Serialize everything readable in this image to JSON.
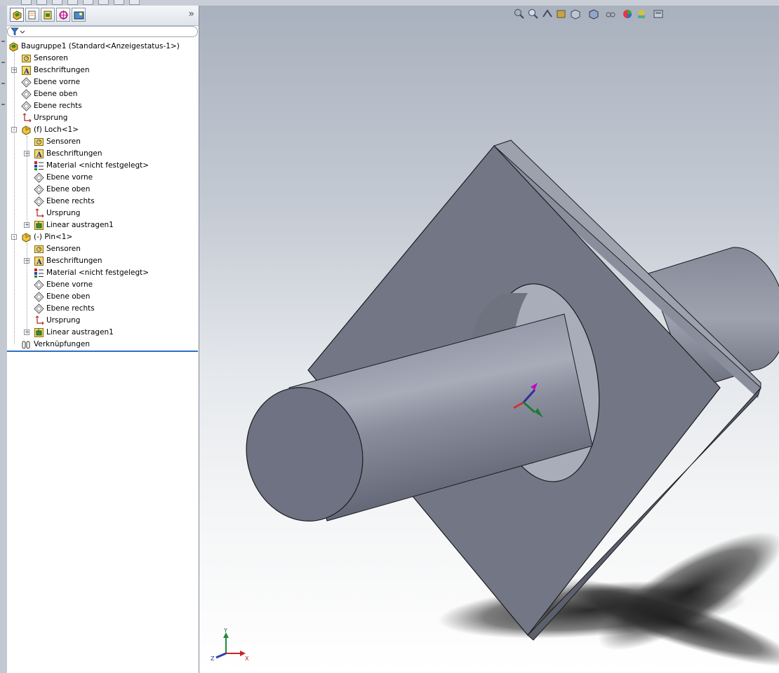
{
  "tree": {
    "root_label": "Baugruppe1  (Standard<Anzeigestatus-1>)",
    "items": [
      {
        "label": "Sensoren",
        "icon": "sensor-icon"
      },
      {
        "label": "Beschriftungen",
        "icon": "annotation-icon"
      },
      {
        "label": "Ebene vorne",
        "icon": "plane-icon"
      },
      {
        "label": "Ebene oben",
        "icon": "plane-icon"
      },
      {
        "label": "Ebene rechts",
        "icon": "plane-icon"
      },
      {
        "label": "Ursprung",
        "icon": "origin-icon"
      }
    ],
    "part1": {
      "label": "(f) Loch<1>",
      "children": [
        {
          "label": "Sensoren"
        },
        {
          "label": "Beschriftungen"
        },
        {
          "label": "Material <nicht festgelegt>"
        },
        {
          "label": "Ebene vorne"
        },
        {
          "label": "Ebene oben"
        },
        {
          "label": "Ebene rechts"
        },
        {
          "label": "Ursprung"
        },
        {
          "label": "Linear austragen1"
        }
      ]
    },
    "part2": {
      "label": "(-) Pin<1>",
      "children": [
        {
          "label": "Sensoren"
        },
        {
          "label": "Beschriftungen"
        },
        {
          "label": "Material <nicht festgelegt>"
        },
        {
          "label": "Ebene vorne"
        },
        {
          "label": "Ebene oben"
        },
        {
          "label": "Ebene rechts"
        },
        {
          "label": "Ursprung"
        },
        {
          "label": "Linear austragen1"
        }
      ]
    },
    "mates_label": "Verknüpfungen"
  },
  "panel": {
    "more_chevron": "»"
  },
  "triad": {
    "x": "X",
    "y": "Y",
    "z": "Z"
  },
  "colors": {
    "model_gray": "#7c808f",
    "selection_blue": "#2e6fc4",
    "viewport_top": "#a9b1be"
  }
}
